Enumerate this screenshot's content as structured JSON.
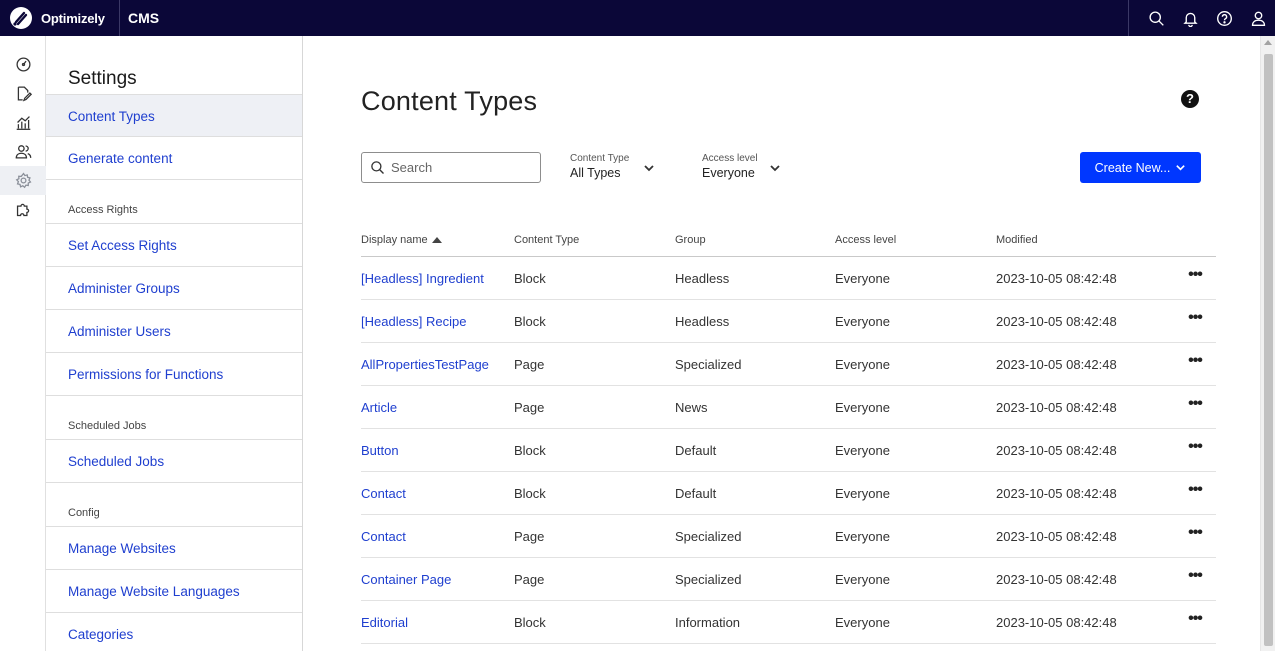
{
  "topbar": {
    "brand": "Optimizely",
    "product": "CMS",
    "icons": [
      "search-icon",
      "bell-icon",
      "help-icon",
      "user-icon"
    ]
  },
  "rail": {
    "icons": [
      "dashboard-icon",
      "edit-icon",
      "analytics-icon",
      "people-icon",
      "gear-icon",
      "addons-icon"
    ],
    "active": "gear-icon"
  },
  "settings": {
    "title": "Settings",
    "items": [
      {
        "label": "Content Types"
      },
      {
        "label": "Generate content"
      }
    ],
    "access_rights": {
      "heading": "Access Rights",
      "items": [
        {
          "label": "Set Access Rights"
        },
        {
          "label": "Administer Groups"
        },
        {
          "label": "Administer Users"
        },
        {
          "label": "Permissions for Functions"
        }
      ]
    },
    "scheduled": {
      "heading": "Scheduled Jobs",
      "items": [
        {
          "label": "Scheduled Jobs"
        }
      ]
    },
    "config": {
      "heading": "Config",
      "items": [
        {
          "label": "Manage Websites"
        },
        {
          "label": "Manage Website Languages"
        },
        {
          "label": "Categories"
        }
      ]
    }
  },
  "main": {
    "title": "Content Types",
    "help": "?",
    "search_placeholder": "Search",
    "filter_type": {
      "label": "Content Type",
      "value": "All Types"
    },
    "filter_access": {
      "label": "Access level",
      "value": "Everyone"
    },
    "create_label": "Create New..."
  },
  "table": {
    "headers": [
      "Display name",
      "Content Type",
      "Group",
      "Access level",
      "Modified"
    ],
    "rows": [
      {
        "name": "[Headless] Ingredient",
        "type": "Block",
        "group": "Headless",
        "access": "Everyone",
        "modified": "2023-10-05 08:42:48"
      },
      {
        "name": "[Headless] Recipe",
        "type": "Block",
        "group": "Headless",
        "access": "Everyone",
        "modified": "2023-10-05 08:42:48"
      },
      {
        "name": "AllPropertiesTestPage",
        "type": "Page",
        "group": "Specialized",
        "access": "Everyone",
        "modified": "2023-10-05 08:42:48"
      },
      {
        "name": "Article",
        "type": "Page",
        "group": "News",
        "access": "Everyone",
        "modified": "2023-10-05 08:42:48"
      },
      {
        "name": "Button",
        "type": "Block",
        "group": "Default",
        "access": "Everyone",
        "modified": "2023-10-05 08:42:48"
      },
      {
        "name": "Contact",
        "type": "Block",
        "group": "Default",
        "access": "Everyone",
        "modified": "2023-10-05 08:42:48"
      },
      {
        "name": "Contact",
        "type": "Page",
        "group": "Specialized",
        "access": "Everyone",
        "modified": "2023-10-05 08:42:48"
      },
      {
        "name": "Container Page",
        "type": "Page",
        "group": "Specialized",
        "access": "Everyone",
        "modified": "2023-10-05 08:42:48"
      },
      {
        "name": "Editorial",
        "type": "Block",
        "group": "Information",
        "access": "Everyone",
        "modified": "2023-10-05 08:42:48"
      }
    ],
    "row_action": "•••"
  }
}
